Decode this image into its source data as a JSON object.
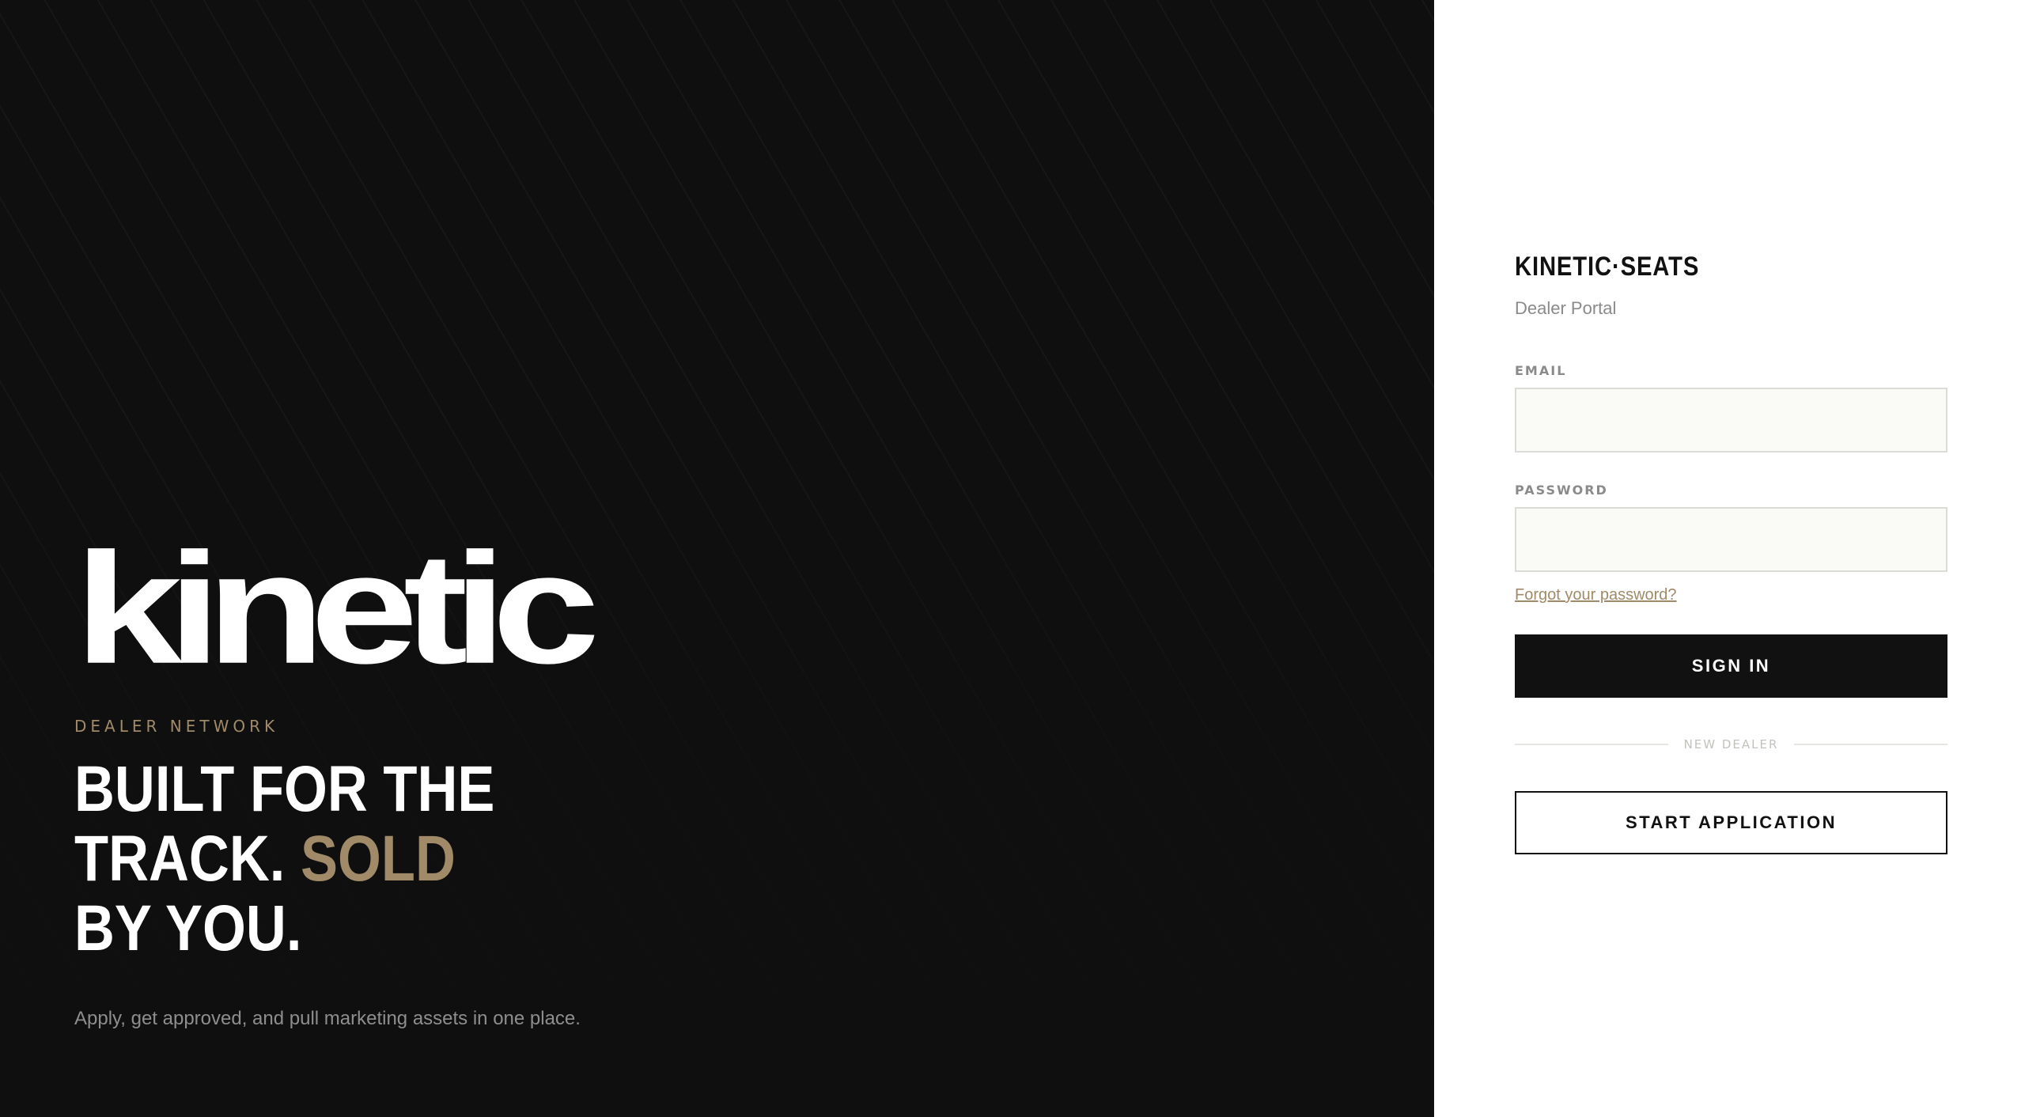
{
  "hero": {
    "wordmark": "kinetic",
    "eyebrow": "DEALER NETWORK",
    "headline": {
      "line1": "BUILT FOR THE",
      "line2_prefix": "TRACK. ",
      "line2_accent": "SOLD",
      "line3": "BY YOU."
    },
    "tagline": "Apply, get approved, and pull marketing assets in one place."
  },
  "auth": {
    "brand": "KINETIC·SEATS",
    "subtitle": "Dealer Portal",
    "email_label": "EMAIL",
    "email_value": "",
    "password_label": "PASSWORD",
    "password_value": "",
    "forgot_link": "Forgot your password?",
    "sign_in_label": "SIGN IN",
    "divider_label": "NEW DEALER",
    "start_application_label": "START APPLICATION"
  },
  "colors": {
    "hero_background": "#0f0f0f",
    "accent": "#a08a68",
    "primary_button": "#111111",
    "input_background": "#fafaf7"
  }
}
